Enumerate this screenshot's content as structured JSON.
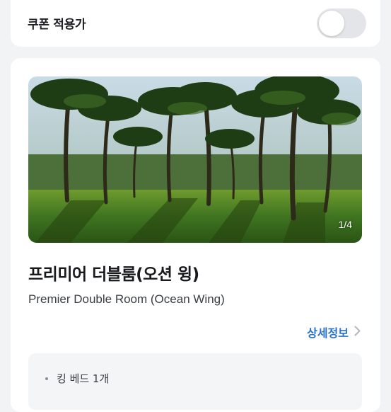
{
  "coupon": {
    "label": "쿠폰 적용가",
    "toggle_on": false
  },
  "room": {
    "photo": {
      "subject": "palm-grove-photo",
      "counter": "1/4"
    },
    "title": "프리미어 더블룸(오션 윙)",
    "subtitle": "Premier Double Room (Ocean Wing)",
    "detail_link": "상세정보",
    "amenities": [
      "킹 베드 1개"
    ]
  },
  "colors": {
    "background": "#f2f3f5",
    "card": "#ffffff",
    "link": "#2b73c9",
    "toggle_off": "#e4e5e8"
  }
}
